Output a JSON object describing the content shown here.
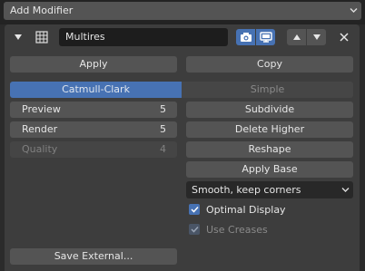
{
  "header": {
    "add_modifier_label": "Add Modifier"
  },
  "modifier": {
    "name": "Multires",
    "apply_label": "Apply",
    "copy_label": "Copy",
    "subdivision_types": [
      {
        "label": "Catmull-Clark",
        "selected": true
      },
      {
        "label": "Simple",
        "selected": false
      }
    ],
    "levels": {
      "preview": {
        "label": "Preview",
        "value": "5"
      },
      "render": {
        "label": "Render",
        "value": "5"
      },
      "quality": {
        "label": "Quality",
        "value": "4"
      }
    },
    "actions": {
      "subdivide": "Subdivide",
      "delete_higher": "Delete Higher",
      "reshape": "Reshape",
      "apply_base": "Apply Base",
      "save_external": "Save External..."
    },
    "uv_smooth": {
      "selected": "Smooth, keep corners"
    },
    "optimal_display": {
      "label": "Optimal Display",
      "checked": true
    },
    "use_creases": {
      "label": "Use Creases",
      "checked": true
    }
  },
  "icons": {
    "collapse": "triangle-down-icon",
    "modifier_type": "multires-grid-icon",
    "render": "camera-icon",
    "viewport": "monitor-icon",
    "move_up": "triangle-up-icon",
    "move_down": "triangle-down-icon",
    "remove": "close-icon"
  },
  "colors": {
    "accent": "#4772b3",
    "button": "#545454",
    "panel": "#3d3d3d",
    "background": "#2b2b2b",
    "field": "#1d1d1d"
  }
}
